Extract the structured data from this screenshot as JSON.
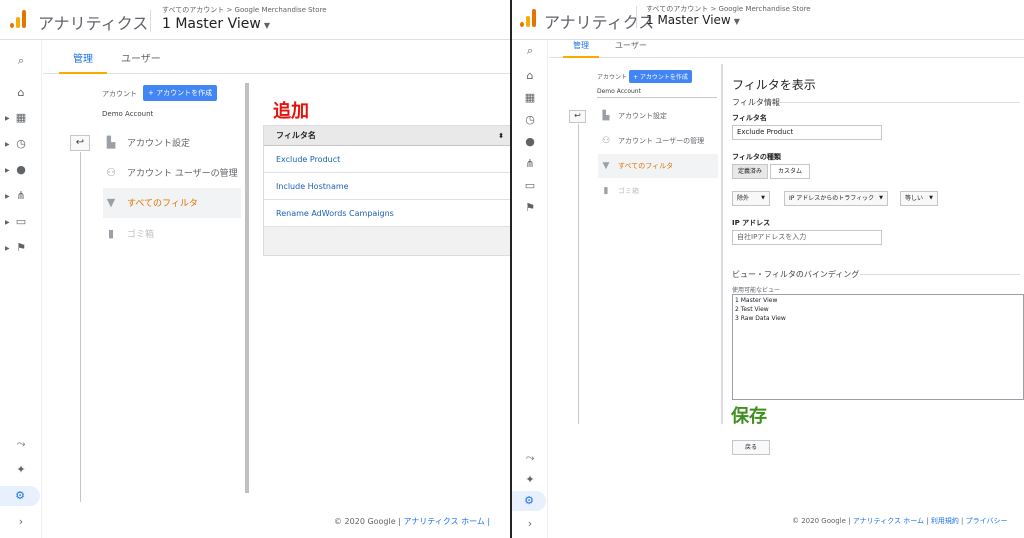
{
  "app": {
    "name": "アナリティクス",
    "breadcrumb": "すべてのアカウント > Google Merchandise Store",
    "view": "1 Master View"
  },
  "tabs": {
    "admin": "管理",
    "user": "ユーザー"
  },
  "account": {
    "label": "アカウント",
    "create_button": "+ アカウントを作成",
    "name": "Demo Account"
  },
  "menu": [
    {
      "label": "アカウント設定",
      "icon": "building-icon"
    },
    {
      "label": "アカウント ユーザーの管理",
      "icon": "people-icon"
    },
    {
      "label": "すべてのフィルタ",
      "icon": "filter-icon"
    },
    {
      "label": "ゴミ箱",
      "icon": "trash-icon"
    }
  ],
  "left": {
    "annotation": "追加",
    "table": {
      "header": "フィルタ名",
      "rows": [
        "Exclude Product",
        "Include Hostname",
        "Rename AdWords Campaigns"
      ]
    },
    "footer": {
      "copyright": "© 2020 Google | ",
      "link": "アナリティクス ホーム |"
    }
  },
  "right": {
    "title": "フィルタを表示",
    "section_info": "フィルタ情報",
    "filter_name_label": "フィルタ名",
    "filter_name_value": "Exclude Product",
    "filter_type_label": "フィルタの種類",
    "type_predefined": "定義済み",
    "type_custom": "カスタム",
    "dd_action": "除外",
    "dd_source": "IP アドレスからのトラフィック",
    "dd_condition": "等しい",
    "ip_label": "IP アドレス",
    "ip_placeholder": "自社IPアドレスを入力",
    "section_binding": "ビュー・フィルタのバインディング",
    "available_views_label": "使用可能なビュー",
    "views": [
      "1 Master View",
      "2 Test View",
      "3 Raw Data View"
    ],
    "annotation": "保存",
    "back_button": "戻る",
    "footer": {
      "copyright": "© 2020 Google | ",
      "link1": "アナリティクス ホーム",
      "sep1": " | ",
      "link2": "利用規約",
      "sep2": " | ",
      "link3": "プライバシー"
    }
  },
  "colors": {
    "annot_red": "#e8120c",
    "annot_green": "#3f8f1f",
    "accent": "#1a73e8",
    "orange": "#e37400"
  }
}
